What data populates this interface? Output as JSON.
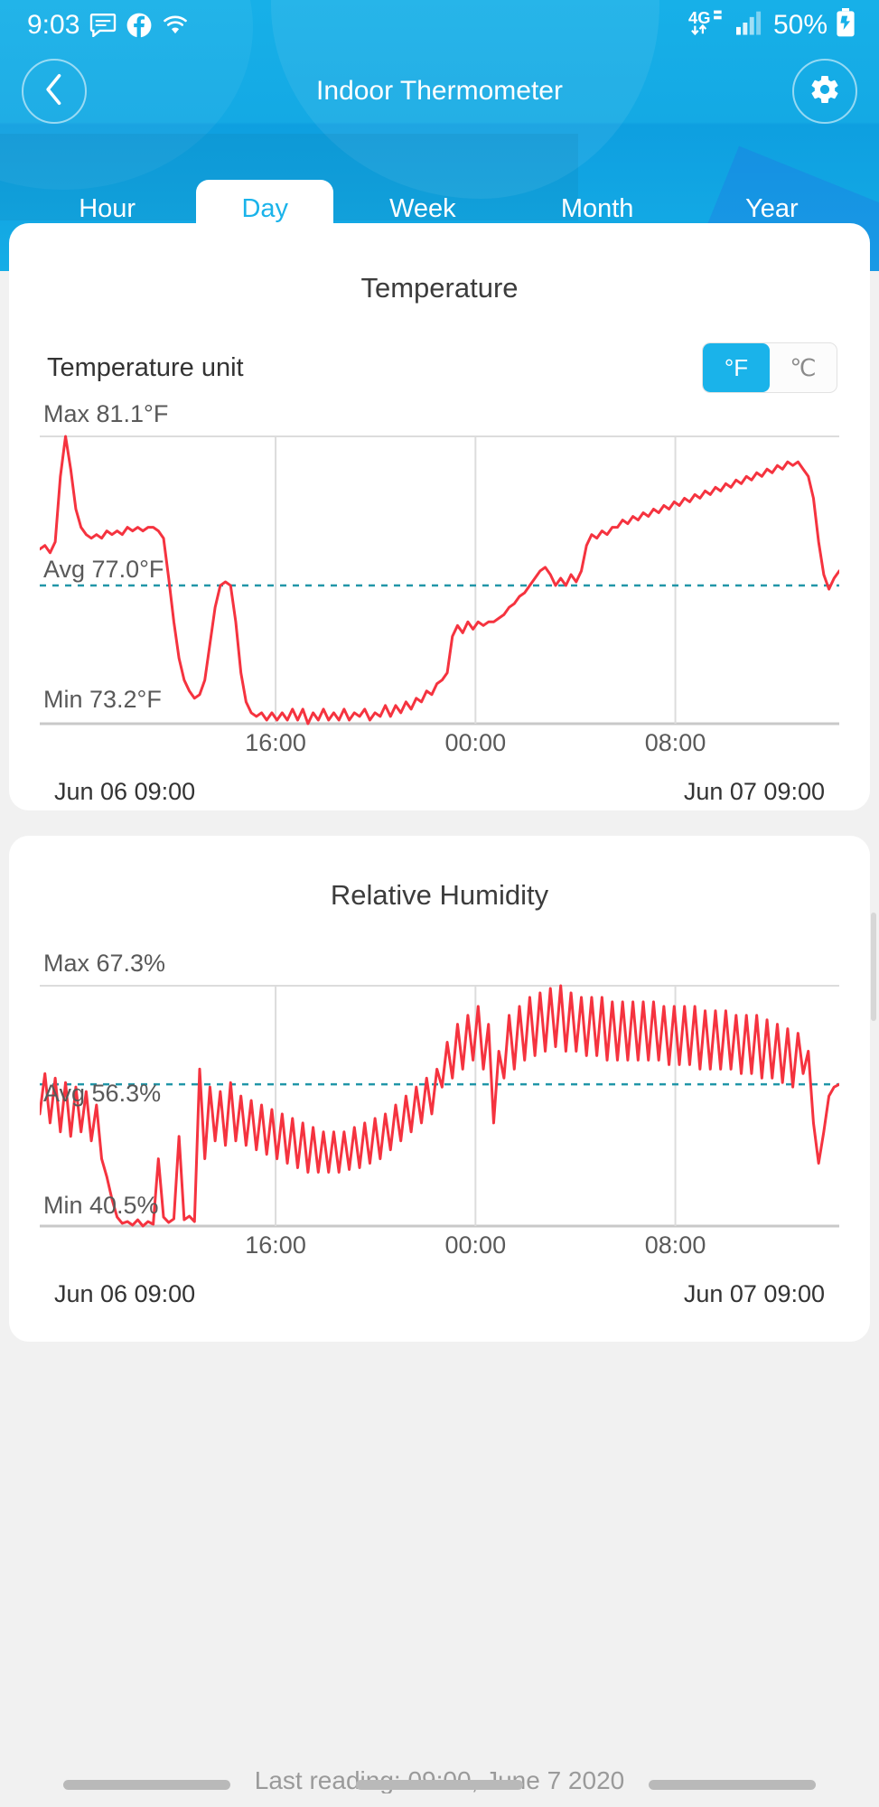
{
  "status_bar": {
    "time": "9:03",
    "icons": [
      "message-icon",
      "facebook-icon",
      "wifi-icon"
    ],
    "network_type": "4G",
    "signal_icon": "signal-bars-icon",
    "battery_percent": "50%",
    "battery_icon": "battery-charging-icon"
  },
  "nav": {
    "back_icon": "chevron-left-icon",
    "title": "Indoor Thermometer",
    "settings_icon": "gear-icon"
  },
  "tabs": [
    {
      "label": "Hour",
      "active": false
    },
    {
      "label": "Day",
      "active": true
    },
    {
      "label": "Week",
      "active": false
    },
    {
      "label": "Month",
      "active": false
    },
    {
      "label": "Year",
      "active": false
    }
  ],
  "temperature_card": {
    "title": "Temperature",
    "unit_setting_label": "Temperature unit",
    "unit_options": [
      "°F",
      "℃"
    ],
    "unit_selected": "°F",
    "max_label": "Max 81.1°F",
    "avg_label": "Avg 77.0°F",
    "min_label": "Min 73.2°F",
    "x_ticks": [
      "16:00",
      "00:00",
      "08:00"
    ],
    "range_start": "Jun 06 09:00",
    "range_end": "Jun 07 09:00"
  },
  "humidity_card": {
    "title": "Relative Humidity",
    "max_label": "Max 67.3%",
    "avg_label": "Avg 56.3%",
    "min_label": "Min 40.5%",
    "x_ticks": [
      "16:00",
      "00:00",
      "08:00"
    ],
    "range_start": "Jun 06 09:00",
    "range_end": "Jun 07 09:00"
  },
  "footer": {
    "last_reading": "Last reading: 09:00, June 7 2020"
  },
  "colors": {
    "brand_blue": "#1ab3ea",
    "series_red": "#f5333f",
    "avg_line": "#2196a8",
    "grid": "#dcdcdc"
  },
  "chart_data": [
    {
      "type": "line",
      "title": "Temperature",
      "ylabel": "°F",
      "xlabel": "",
      "unit": "°F",
      "max": 81.1,
      "avg": 77.0,
      "min": 73.2,
      "ylim": [
        73.2,
        81.1
      ],
      "x_start": "Jun 06 09:00",
      "x_end": "Jun 07 09:00",
      "x_ticks": [
        "16:00",
        "00:00",
        "08:00"
      ],
      "grid": true,
      "legend": "none",
      "series": [
        {
          "name": "Temperature",
          "color": "#f5333f",
          "values": [
            78.0,
            78.1,
            77.9,
            78.2,
            80.0,
            81.1,
            80.2,
            79.1,
            78.6,
            78.4,
            78.3,
            78.4,
            78.3,
            78.5,
            78.4,
            78.5,
            78.4,
            78.6,
            78.5,
            78.6,
            78.5,
            78.6,
            78.6,
            78.5,
            78.3,
            77.2,
            76.0,
            75.0,
            74.4,
            74.1,
            73.9,
            74.0,
            74.4,
            75.4,
            76.4,
            77.0,
            77.1,
            77.0,
            76.0,
            74.6,
            73.8,
            73.5,
            73.4,
            73.5,
            73.3,
            73.5,
            73.3,
            73.5,
            73.3,
            73.6,
            73.3,
            73.6,
            73.2,
            73.5,
            73.3,
            73.6,
            73.3,
            73.5,
            73.3,
            73.6,
            73.3,
            73.5,
            73.4,
            73.6,
            73.3,
            73.5,
            73.4,
            73.7,
            73.4,
            73.7,
            73.5,
            73.8,
            73.6,
            73.9,
            73.8,
            74.1,
            74.0,
            74.3,
            74.4,
            74.6,
            75.6,
            75.9,
            75.7,
            76.0,
            75.8,
            76.0,
            75.9,
            76.0,
            76.0,
            76.1,
            76.2,
            76.4,
            76.5,
            76.7,
            76.8,
            77.0,
            77.2,
            77.4,
            77.5,
            77.3,
            77.0,
            77.2,
            77.0,
            77.3,
            77.1,
            77.4,
            78.1,
            78.4,
            78.3,
            78.5,
            78.4,
            78.6,
            78.6,
            78.8,
            78.7,
            78.9,
            78.8,
            79.0,
            78.9,
            79.1,
            79.0,
            79.2,
            79.1,
            79.3,
            79.2,
            79.4,
            79.3,
            79.5,
            79.4,
            79.6,
            79.5,
            79.7,
            79.6,
            79.8,
            79.7,
            79.9,
            79.8,
            80.0,
            79.9,
            80.1,
            80.0,
            80.2,
            80.1,
            80.3,
            80.2,
            80.4,
            80.3,
            80.4,
            80.2,
            80.0,
            79.4,
            78.2,
            77.3,
            76.9,
            77.2,
            77.4
          ]
        }
      ],
      "avg_reference_line": 77.0
    },
    {
      "type": "line",
      "title": "Relative Humidity",
      "ylabel": "%",
      "xlabel": "",
      "unit": "%",
      "max": 67.3,
      "avg": 56.3,
      "min": 40.5,
      "ylim": [
        40.5,
        67.3
      ],
      "x_start": "Jun 06 09:00",
      "x_end": "Jun 07 09:00",
      "x_ticks": [
        "16:00",
        "00:00",
        "08:00"
      ],
      "grid": true,
      "legend": "none",
      "series": [
        {
          "name": "Relative Humidity",
          "color": "#f5333f",
          "values": [
            53.0,
            57.5,
            52.0,
            57.0,
            51.0,
            56.5,
            50.5,
            56.0,
            51.0,
            55.5,
            50.0,
            54.0,
            48.0,
            46.0,
            43.5,
            41.5,
            40.8,
            41.0,
            40.6,
            41.2,
            40.5,
            41.0,
            40.7,
            48.0,
            41.5,
            40.9,
            41.3,
            50.5,
            41.2,
            41.6,
            41.0,
            58.0,
            48.0,
            56.0,
            50.0,
            55.5,
            49.5,
            56.5,
            50.0,
            55.0,
            49.5,
            54.5,
            49.0,
            54.0,
            48.5,
            53.5,
            48.0,
            53.0,
            47.5,
            52.5,
            47.0,
            52.0,
            46.5,
            51.5,
            46.5,
            51.0,
            46.5,
            51.0,
            46.5,
            51.0,
            46.8,
            51.5,
            47.0,
            52.0,
            47.5,
            52.5,
            48.0,
            53.0,
            49.0,
            54.0,
            50.0,
            55.0,
            51.0,
            56.0,
            52.0,
            57.0,
            53.0,
            58.0,
            56.0,
            61.0,
            57.0,
            63.0,
            58.0,
            64.0,
            59.0,
            65.0,
            58.0,
            63.0,
            52.0,
            60.0,
            57.0,
            64.0,
            58.0,
            65.0,
            59.0,
            66.0,
            59.5,
            66.5,
            60.0,
            67.0,
            60.5,
            67.3,
            60.0,
            66.5,
            60.0,
            66.0,
            59.5,
            66.0,
            59.5,
            66.0,
            59.0,
            65.5,
            59.0,
            65.5,
            59.0,
            65.5,
            59.0,
            65.5,
            59.0,
            65.5,
            59.0,
            65.0,
            58.5,
            65.0,
            58.5,
            65.0,
            58.5,
            65.0,
            58.0,
            64.5,
            58.0,
            64.5,
            58.0,
            64.5,
            58.0,
            64.0,
            57.5,
            64.0,
            57.5,
            64.0,
            57.0,
            63.5,
            57.0,
            63.0,
            56.5,
            62.5,
            56.0,
            62.0,
            57.5,
            60.0,
            52.0,
            47.5,
            51.0,
            55.0,
            56.0,
            56.3
          ]
        }
      ],
      "avg_reference_line": 56.3
    }
  ]
}
